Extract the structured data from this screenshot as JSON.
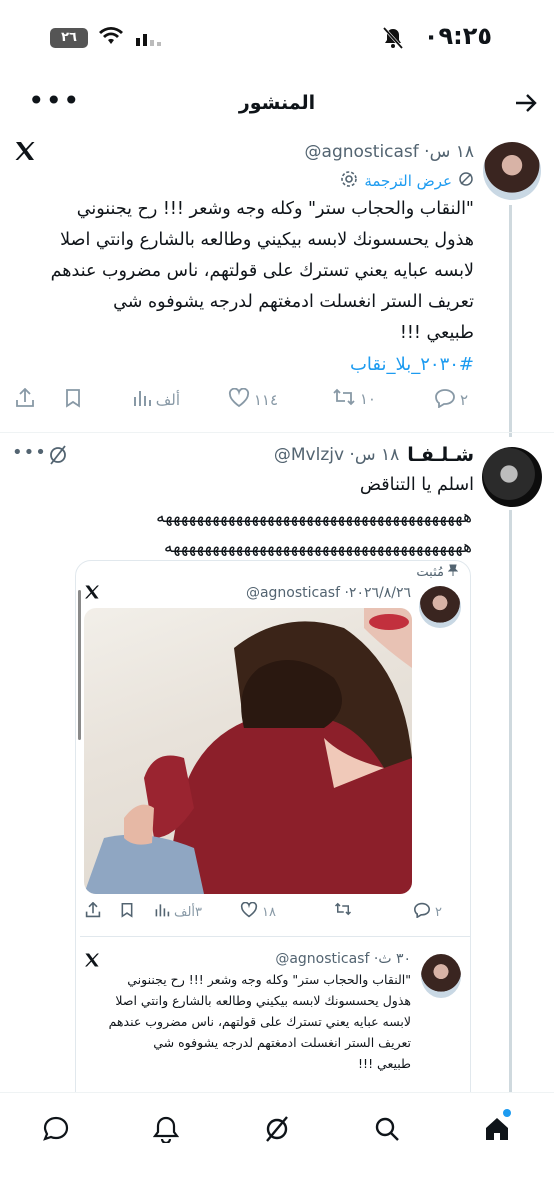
{
  "status_bar": {
    "time": "٠٩:٢٥",
    "battery": "٢٦"
  },
  "header": {
    "title": "المنشور"
  },
  "tweet": {
    "handle_time": "@agnosticasf ·١٨ س",
    "translate_label": "عرض الترجمة",
    "text_lines": [
      "\"النقاب والحجاب ستر\" وكله وجه وشعر !!! رح يجننوني",
      "هذول يحسسونك لابسه بيكيني وطالعه بالشارع وانتي اصلا",
      "لابسه عبايه يعني تسترك على قولتهم، ناس مضروب عندهم",
      "تعريف الستر انغسلت ادمغتهم لدرجه يشوفوه شي",
      "طبيعي !!!"
    ],
    "hashtag": "#٢٠٣٠_بلا_نقاب",
    "replies": "٢",
    "retweets": "١٠",
    "likes": "١١٤",
    "views": "ألف"
  },
  "reply": {
    "display_name": "شـلـفـا",
    "handle_time": "@Mvlzjv ·١٨ س",
    "line1": "اسلم يا التناقض",
    "line2": "هههههههههههههههههههههههههههههههههههههههه",
    "line3": "ههههههههههههههههههههههههههههههههههههههه"
  },
  "quoted": {
    "pinned_label": "مُثبت",
    "handle_date": "@agnosticasf ·٢٠٢٦/٨/٢٦",
    "replies": "٢",
    "likes": "١٨",
    "views": "٣ألف"
  },
  "inner_quote": {
    "handle_time": "@agnosticasf ·٣٠ ث",
    "text_lines": [
      "\"النقاب والحجاب ستر\" وكله وجه وشعر !!! رح يجننوني",
      "هذول يحسسونك لابسه بيكيني وطالعه بالشارع وانتي اصلا",
      "لابسه عبايه يعني تسترك على قولتهم، ناس مضروب عندهم",
      "تعريف الستر انغسلت ادمغتهم لدرجه يشوفوه شي",
      "طبيعي !!!"
    ]
  },
  "nav": [
    "home-icon",
    "search-icon",
    "grok-icon",
    "notifications-icon",
    "messages-icon"
  ],
  "colors": {
    "link": "#1d9bf0",
    "muted": "#536471",
    "notification_dot": "#1d9bf0"
  }
}
